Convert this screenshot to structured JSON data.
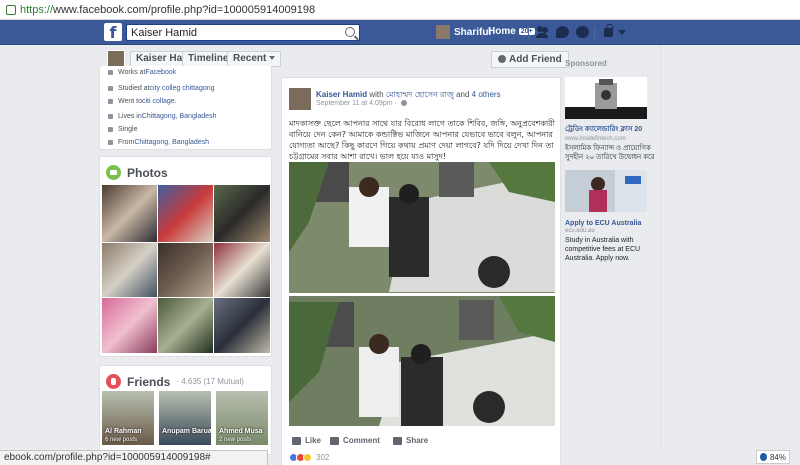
{
  "browser": {
    "url_protocol": "https://",
    "url_rest": "www.facebook.com/profile.php?id=100005914009198",
    "status_url": "ebook.com/profile.php?id=100005914009198#",
    "zoom": "84%"
  },
  "topbar": {
    "logo": "f",
    "search_value": "Kaiser Hamid",
    "user_name": "Shariful",
    "home_label": "Home",
    "home_count": "20+"
  },
  "profile_nav": {
    "name": "Kaiser Hamid",
    "timeline_label": "Timeline",
    "recent_label": "Recent",
    "add_friend_label": "Add Friend"
  },
  "intro": {
    "works_prefix": "Works at ",
    "works_link": "Facebook",
    "studied_prefix": "Studied at ",
    "studied_link": "city colleg chittagong",
    "went_prefix": "Went to ",
    "went_link": "citi collage.",
    "lives_prefix": "Lives in ",
    "lives_link": "Chittagong, Bangladesh",
    "relationship": "Single",
    "from_prefix": "From ",
    "from_link": "Chittagong, Bangladesh"
  },
  "photos": {
    "title": "Photos",
    "tiles": [
      {
        "colors": [
          "#4a3a30",
          "#c9b8a5",
          "#2b2b35"
        ]
      },
      {
        "colors": [
          "#3f5fa0",
          "#c83a3a",
          "#d9d3c5"
        ]
      },
      {
        "colors": [
          "#5b6a4a",
          "#2a2a2a",
          "#a08a70"
        ]
      },
      {
        "colors": [
          "#8c7b6a",
          "#d5d0c6",
          "#405060"
        ]
      },
      {
        "colors": [
          "#3a2f2a",
          "#6f5e50",
          "#b9a894"
        ]
      },
      {
        "colors": [
          "#8f2f3a",
          "#e8e0d2",
          "#3a3a3a"
        ]
      },
      {
        "colors": [
          "#d86a9a",
          "#f0c0d0",
          "#8a3a5a"
        ]
      },
      {
        "colors": [
          "#4a5a3a",
          "#a8b090",
          "#20301f"
        ]
      },
      {
        "colors": [
          "#6a7080",
          "#2a2f3a",
          "#c0b8a8"
        ]
      }
    ]
  },
  "friends": {
    "title": "Friends",
    "count": "· 4,635 (17 Mutual)",
    "items": [
      {
        "name": "Al Rahman",
        "sub": "6 new posts",
        "color": "#6a5a48"
      },
      {
        "name": "Anupam Barua",
        "sub": "",
        "color": "#3a4a5a"
      },
      {
        "name": "Ahmed Musa",
        "sub": "2 new posts",
        "color": "#7a8a6a"
      }
    ]
  },
  "post": {
    "author": "Kaiser Hamid",
    "with_text": " with ",
    "with_link": "মোহাম্মদ হোসেন রাজু",
    "and_text": " and ",
    "others_link": "4 others",
    "time": "September 11 at 4:09pm · ",
    "text": "মাদকাসক্ত ছেলে আপনার সাথে যার বিরোধ লাগে তাকে শিবির, জঙ্গি, অনুপ্রবেশকারী বানিয়ে দেন কেন? আমাকে কন্ডাক্টিভ মাজিনে আপনার যেভাবে ভাবে বলুন, আপনার যোগ্যতা আছে? কিছু কারণে গিয়ে কথায় প্রমাণ দেয়া লাগবে? যদি দিয়ে দেখা দিন তা চট্টগ্রামের সবার আশা রাখে। ভাল হয়ে যাও মাসুদ!",
    "like_label": "Like",
    "comment_label": "Comment",
    "share_label": "Share",
    "reaction_count": "302"
  },
  "sponsored": {
    "heading": "Sponsored",
    "ad1_title": "ট্রেডিং ক্যালেন্ডারিং ক্লাস 20",
    "ad1_site": "www.insidefintech.com",
    "ad1_desc": "ইসলামিক ফিন্যান্স ও প্রায়োগিক সুদহীন ২০ তারিখে উদ্বোধন করে",
    "ad2_title": "Apply to ECU Australia",
    "ad2_site": "ecu.edu.au",
    "ad2_desc": "Study in Australia with competitive fees at ECU Australia. Apply now."
  }
}
